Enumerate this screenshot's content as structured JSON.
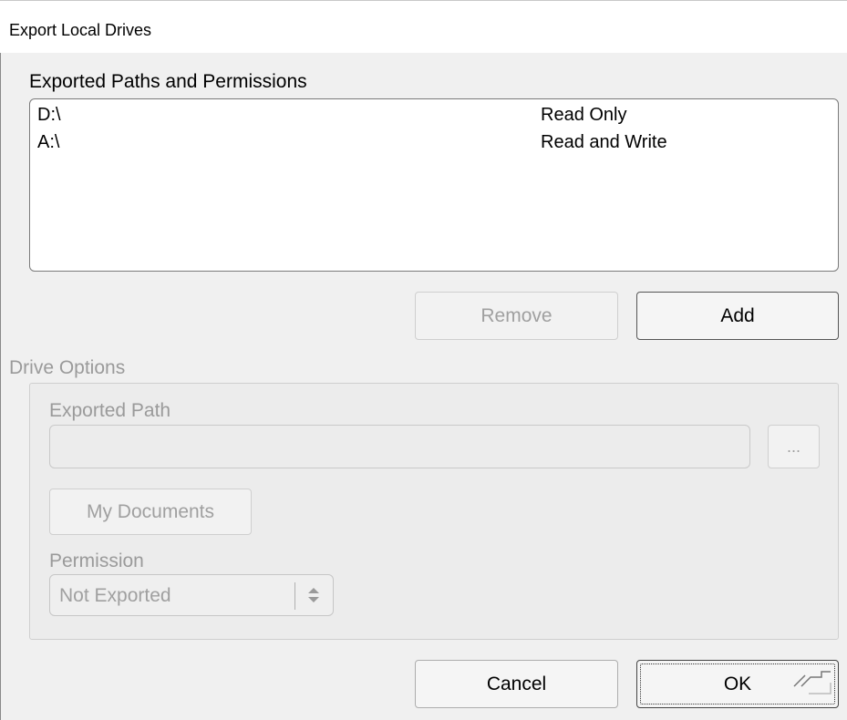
{
  "window": {
    "title": "Export Local Drives"
  },
  "exports": {
    "label": "Exported Paths and Permissions",
    "rows": [
      {
        "path": "D:\\",
        "permission": "Read Only"
      },
      {
        "path": "A:\\",
        "permission": "Read and Write"
      }
    ],
    "remove_label": "Remove",
    "add_label": "Add"
  },
  "drive_options": {
    "label": "Drive Options",
    "exported_path_label": "Exported Path",
    "exported_path_value": "",
    "browse_label": "...",
    "my_documents_label": "My Documents",
    "permission_label": "Permission",
    "permission_value": "Not Exported"
  },
  "dialog_buttons": {
    "cancel_label": "Cancel",
    "ok_label": "OK"
  }
}
